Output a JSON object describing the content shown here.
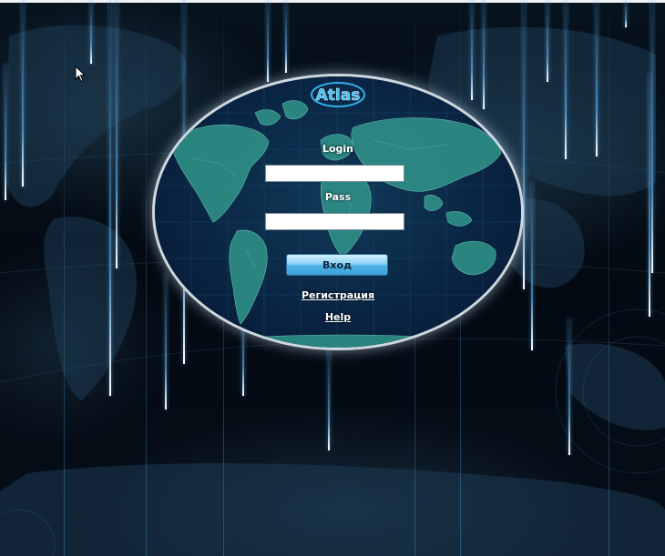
{
  "logo": {
    "text": "Atlas",
    "color": "#2fb0ea"
  },
  "login_form": {
    "login_label": "Login",
    "login_value": "",
    "pass_label": "Pass",
    "pass_value": "",
    "submit_label": "Вход",
    "register_link": "Регистрация",
    "help_link": "Help"
  },
  "theme": {
    "background": "#020812",
    "oval_border": "#cfd8e0",
    "button_color": "#4fb2e6",
    "map_land": "#2f8f86"
  }
}
